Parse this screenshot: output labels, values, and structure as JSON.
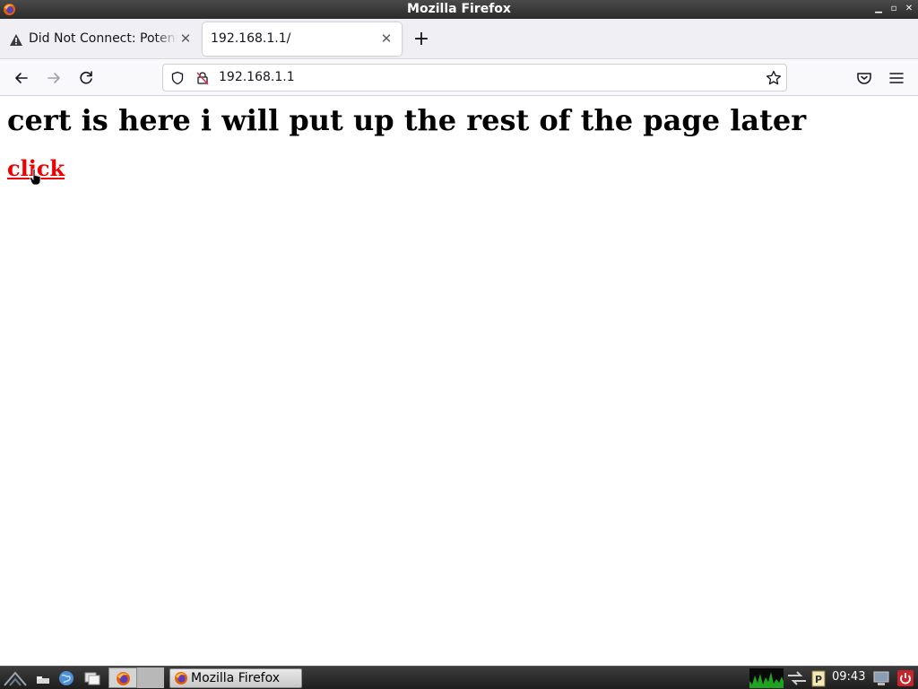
{
  "window": {
    "title": "Mozilla Firefox",
    "controls": [
      "minimize-icon",
      "maximize-icon",
      "close-icon"
    ]
  },
  "tabs": [
    {
      "label": "Did Not Connect: Potential Security Issue",
      "icon": "warning-icon",
      "active": false
    },
    {
      "label": "192.168.1.1/",
      "icon": "",
      "active": true
    }
  ],
  "tabstrip": {
    "new_tab": "+"
  },
  "navbar": {
    "url": "192.168.1.1",
    "icons": [
      "back-icon",
      "forward-icon",
      "reload-icon",
      "shield-icon",
      "insecure-lock-icon",
      "bookmark-star-icon",
      "pocket-icon",
      "menu-icon"
    ]
  },
  "page": {
    "heading": "cert is here i will put up the rest of the page later",
    "link_text": "click",
    "link_color": "#ee0000"
  },
  "taskbar": {
    "task_label": "Mozilla Firefox",
    "clock": "09:43"
  }
}
